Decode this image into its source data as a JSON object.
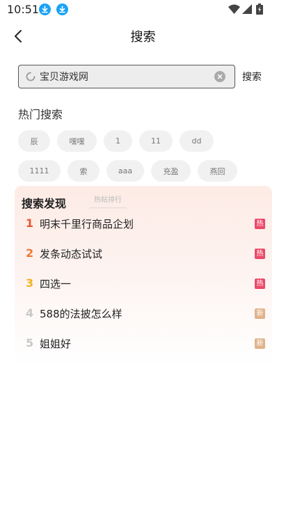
{
  "status_bar": {
    "time": "10:51"
  },
  "header": {
    "title": "搜索"
  },
  "search": {
    "value": "宝贝游戏网",
    "submit_label": "搜索"
  },
  "hot_search": {
    "title": "热门搜索",
    "tags": [
      "辰",
      "嘿嘿",
      "1",
      "11",
      "dd",
      "1111",
      "索",
      "aaa",
      "充盈",
      "燕回"
    ]
  },
  "discovery": {
    "title": "搜索发现",
    "tab_label": "热帖排行",
    "items": [
      {
        "rank": "1",
        "text": "明末千里行商品企划",
        "badge": "热",
        "rank_color": "#e8552f",
        "badge_color": "#ec4a6a"
      },
      {
        "rank": "2",
        "text": "发条动态试试",
        "badge": "热",
        "rank_color": "#f07a34",
        "badge_color": "#ec4a6a"
      },
      {
        "rank": "3",
        "text": "四选一",
        "badge": "热",
        "rank_color": "#f3b321",
        "badge_color": "#ec4a6a"
      },
      {
        "rank": "4",
        "text": "588的法披怎么样",
        "badge": "新",
        "rank_color": "#c8c8c8",
        "badge_color": "#e0b28b"
      },
      {
        "rank": "5",
        "text": "姐姐好",
        "badge": "新",
        "rank_color": "#c8c8c8",
        "badge_color": "#e0b28b"
      }
    ]
  }
}
